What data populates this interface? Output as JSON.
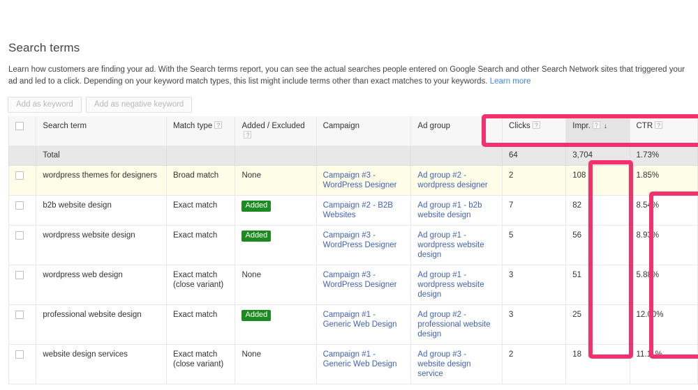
{
  "page": {
    "title": "Search terms",
    "intro_text": "Learn how customers are finding your ad. With the Search terms report, you can see the actual searches people entered on Google Search and other Search Network sites that triggered your ad and led to a click. Depending on your keyword match types, this list might include terms other than exact matches to your keywords. ",
    "intro_link": "Learn more"
  },
  "toolbar": {
    "add_keyword_label": "Add as keyword",
    "add_negative_keyword_label": "Add as negative keyword"
  },
  "table": {
    "headers": {
      "search_term": "Search term",
      "match_type": "Match type",
      "added_excluded": "Added / Excluded",
      "campaign": "Campaign",
      "ad_group": "Ad group",
      "clicks": "Clicks",
      "impr": "Impr.",
      "ctr": "CTR"
    },
    "help_glyph": "?",
    "sort_arrow": "↓",
    "sorted_column": "impr",
    "total_row": {
      "label": "Total",
      "clicks": "64",
      "impr": "3,704",
      "ctr": "1.73%"
    },
    "rows": [
      {
        "search_term": "wordpress themes for designers",
        "match_type": "Broad match",
        "added_excluded": "None",
        "added_excluded_is_badge": false,
        "campaign": "Campaign #3 - WordPress Designer",
        "ad_group": "Ad group #2 - wordpress designer",
        "clicks": "2",
        "impr": "108",
        "ctr": "1.85%",
        "highlighted_row": true
      },
      {
        "search_term": "b2b website design",
        "match_type": "Exact match",
        "added_excluded": "Added",
        "added_excluded_is_badge": true,
        "campaign": "Campaign #2 - B2B Websites",
        "ad_group": "Ad group #1 - b2b website design",
        "clicks": "7",
        "impr": "82",
        "ctr": "8.54%",
        "highlighted_row": false
      },
      {
        "search_term": "wordpress website design",
        "match_type": "Exact match",
        "added_excluded": "Added",
        "added_excluded_is_badge": true,
        "campaign": "Campaign #3 - WordPress Designer",
        "ad_group": "Ad group #1 - wordpress website design",
        "clicks": "5",
        "impr": "56",
        "ctr": "8.93%",
        "highlighted_row": false
      },
      {
        "search_term": "wordpress web design",
        "match_type": "Exact match (close variant)",
        "added_excluded": "None",
        "added_excluded_is_badge": false,
        "campaign": "Campaign #3 - WordPress Designer",
        "ad_group": "Ad group #1 - wordpress website design",
        "clicks": "3",
        "impr": "51",
        "ctr": "5.88%",
        "highlighted_row": false
      },
      {
        "search_term": "professional website design",
        "match_type": "Exact match",
        "added_excluded": "Added",
        "added_excluded_is_badge": true,
        "campaign": "Campaign #1 - Generic Web Design",
        "ad_group": "Ad group #2 - professional website design",
        "clicks": "3",
        "impr": "25",
        "ctr": "12.00%",
        "highlighted_row": false
      },
      {
        "search_term": "website design services",
        "match_type": "Exact match (close variant)",
        "added_excluded": "None",
        "added_excluded_is_badge": false,
        "campaign": "Campaign #1 - Generic Web Design",
        "ad_group": "Ad group #3 - website design service",
        "clicks": "2",
        "impr": "18",
        "ctr": "11.11%",
        "highlighted_row": false
      }
    ]
  },
  "annotations": {
    "highlight_color": "#f4306d",
    "boxes": [
      {
        "name": "metrics-header-highlight",
        "target": "Clicks / Impr. / CTR column headers"
      },
      {
        "name": "impressions-column-highlight",
        "target": "Impr. values"
      },
      {
        "name": "ctr-column-highlight",
        "target": "CTR values"
      }
    ]
  },
  "colors": {
    "link": "#4162b4",
    "added_badge": "#1c8a22",
    "highlighted_row_bg": "#fdfde8"
  }
}
